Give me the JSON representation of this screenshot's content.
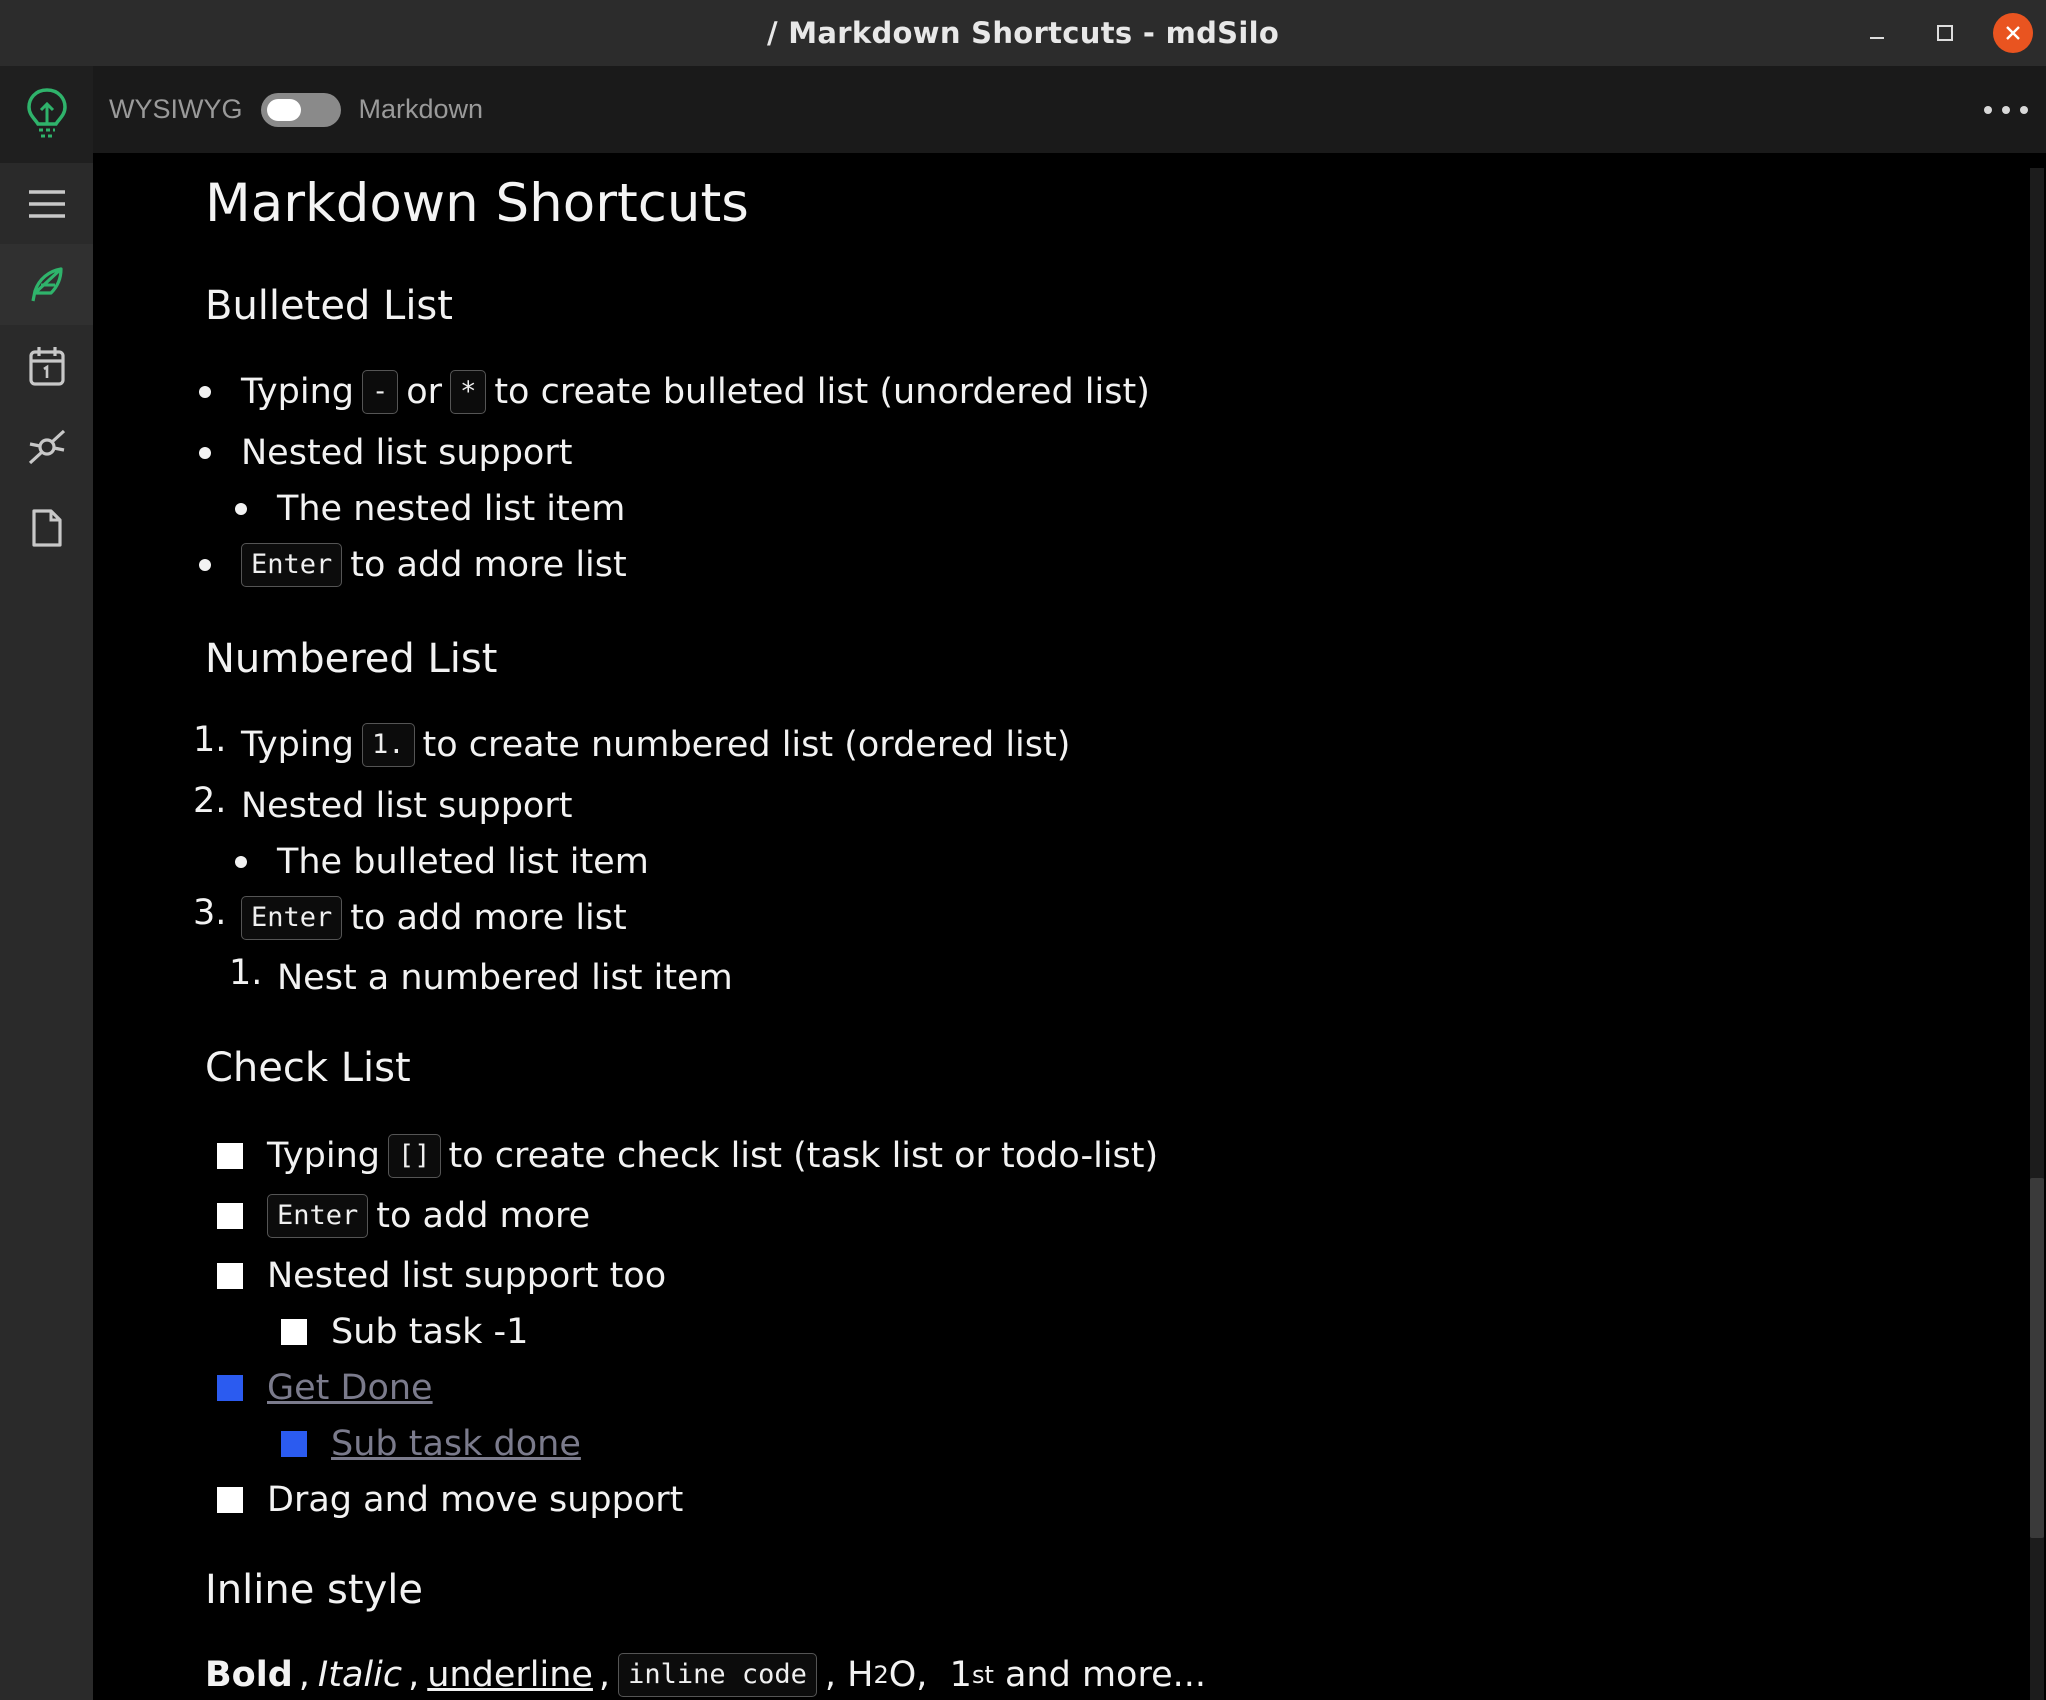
{
  "window": {
    "title": "/ Markdown Shortcuts - mdSilo"
  },
  "toolbar": {
    "mode_left": "WYSIWYG",
    "mode_right": "Markdown"
  },
  "sidebar": {
    "items": [
      "menu-icon",
      "feather-icon",
      "calendar-icon",
      "graph-icon",
      "file-icon"
    ]
  },
  "doc": {
    "title": "Markdown Shortcuts",
    "bulleted": {
      "heading": "Bulleted List",
      "l1_a": "Typing",
      "l1_code1": "-",
      "l1_or": "or",
      "l1_code2": "*",
      "l1_b": "to create bulleted list (unordered list)",
      "l2": "Nested list support",
      "l3": "The nested list item",
      "l4_code": "Enter",
      "l4": "to add more list"
    },
    "numbered": {
      "heading": "Numbered List",
      "n1": "1.",
      "l1_a": "Typing",
      "l1_code": "1.",
      "l1_b": "to create numbered list (ordered list)",
      "n2": "2.",
      "l2": "Nested list support",
      "l3": "The bulleted list item",
      "n3": "3.",
      "l4_code": "Enter",
      "l4": "to add more list",
      "n5": "1.",
      "l5": "Nest a numbered list item"
    },
    "check": {
      "heading": "Check List",
      "c1_a": "Typing",
      "c1_code": "[]",
      "c1_b": "to create check list (task list or todo-list)",
      "c2_code": "Enter",
      "c2": "to add more",
      "c3": "Nested list support too",
      "c4": "Sub task -1",
      "c5": "Get Done",
      "c6": "Sub task done",
      "c7": "Drag and move support"
    },
    "inline": {
      "heading": "Inline style",
      "bold": "Bold",
      "sep1": ",",
      "italic": "Italic",
      "sep2": ",",
      "underline": "underline",
      "sep3": ",",
      "code": "inline code",
      "sep4": ", H",
      "sub": "2",
      "after_sub": "O,  1",
      "sup": "st",
      "rest": " and more..."
    }
  },
  "colors": {
    "accent_green": "#2fb36b",
    "checkbox_done": "#2b5bf0",
    "close_button": "#e95420"
  }
}
